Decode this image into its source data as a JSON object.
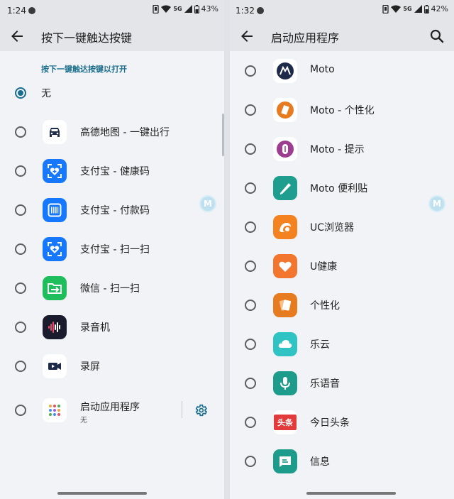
{
  "left": {
    "status": {
      "time": "1:24",
      "network": "5G",
      "battery": "43%"
    },
    "title": "按下一键触达按键",
    "section_label": "按下一键触达按键以打开",
    "none_option": "无",
    "items": [
      {
        "label": "高德地图 - 一键出行",
        "icon": "car-icon",
        "color": "#ffffff"
      },
      {
        "label": "支付宝 - 健康码",
        "icon": "alipay-health-icon",
        "color": "#1677ff"
      },
      {
        "label": "支付宝 - 付款码",
        "icon": "alipay-pay-icon",
        "color": "#1677ff"
      },
      {
        "label": "支付宝 - 扫一扫",
        "icon": "alipay-scan-icon",
        "color": "#1677ff"
      },
      {
        "label": "微信 - 扫一扫",
        "icon": "wechat-scan-icon",
        "color": "#1fbe5c"
      },
      {
        "label": "录音机",
        "icon": "recorder-icon",
        "color": "#1a1c2e"
      },
      {
        "label": "录屏",
        "icon": "screen-record-icon",
        "color": "#ffffff"
      }
    ],
    "launch_app": {
      "label": "启动应用程序",
      "value": "无",
      "icon": "app-grid-icon"
    },
    "float_label": "M"
  },
  "right": {
    "status": {
      "time": "1:32",
      "network": "5G",
      "battery": "42%"
    },
    "title": "启动应用程序",
    "apps": [
      {
        "label": "Moto",
        "icon": "moto-icon",
        "color": "#ffffff"
      },
      {
        "label": "Moto - 个性化",
        "icon": "moto-personalize-icon",
        "color": "#ffffff"
      },
      {
        "label": "Moto - 提示",
        "icon": "moto-tips-icon",
        "color": "#ffffff"
      },
      {
        "label": "Moto 便利贴",
        "icon": "sticky-note-icon",
        "color": "#1f9e8f"
      },
      {
        "label": "UC浏览器",
        "icon": "uc-browser-icon",
        "color": "#f58220"
      },
      {
        "label": "U健康",
        "icon": "heart-icon",
        "color": "#f2762e"
      },
      {
        "label": "个性化",
        "icon": "personalize-icon",
        "color": "#e67b1f"
      },
      {
        "label": "乐云",
        "icon": "cloud-icon",
        "color": "#2fc3c3"
      },
      {
        "label": "乐语音",
        "icon": "microphone-icon",
        "color": "#1e9c8b"
      },
      {
        "label": "今日头条",
        "icon": "toutiao-icon",
        "color": "#ffffff",
        "text": "头条"
      },
      {
        "label": "信息",
        "icon": "message-icon",
        "color": "#1e9c8b"
      }
    ],
    "float_label": "M"
  }
}
